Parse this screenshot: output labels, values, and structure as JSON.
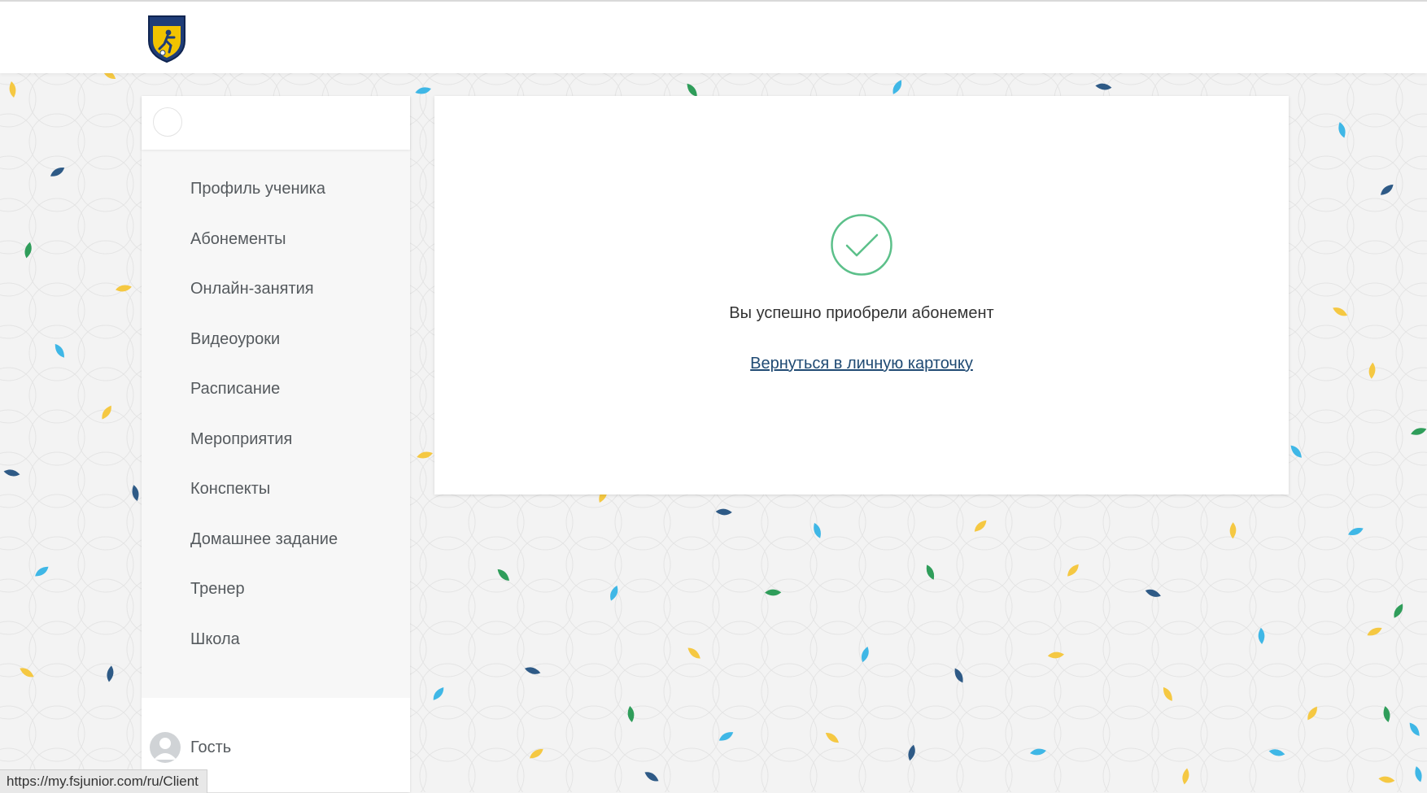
{
  "header": {
    "logo_icon": "junior-shield-logo"
  },
  "sidebar": {
    "items": [
      {
        "label": "Профиль ученика"
      },
      {
        "label": "Абонементы"
      },
      {
        "label": "Онлайн-занятия"
      },
      {
        "label": "Видеоуроки"
      },
      {
        "label": "Расписание"
      },
      {
        "label": "Мероприятия"
      },
      {
        "label": "Конспекты"
      },
      {
        "label": "Домашнее задание"
      },
      {
        "label": "Тренер"
      },
      {
        "label": "Школа"
      }
    ],
    "user": {
      "name": "Гость",
      "avatar_icon": "user-avatar-icon"
    }
  },
  "main": {
    "success_icon": "checkmark-circle-icon",
    "message": "Вы успешно приобрели абонемент",
    "back_link": "Вернуться в личную карточку"
  },
  "statusbar": {
    "url": "https://my.fsjunior.com/ru/Client"
  },
  "colors": {
    "accent_green": "#5cc08a",
    "link": "#1f4a73",
    "confetti": [
      "#f5c842",
      "#3fb7e6",
      "#2f9d5a",
      "#2e5a86"
    ]
  }
}
